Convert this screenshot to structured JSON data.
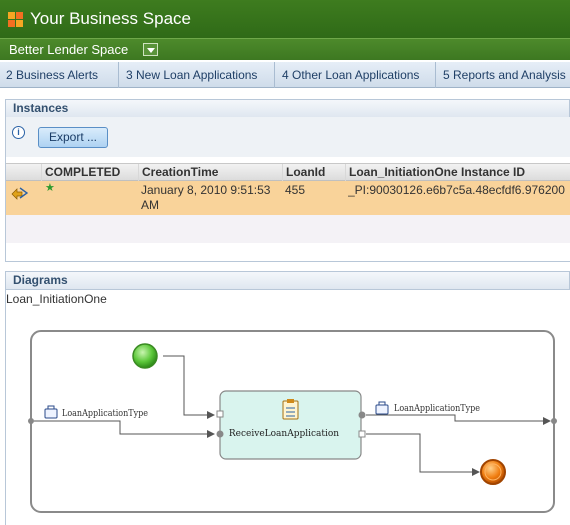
{
  "header": {
    "app_title": "Your Business Space",
    "space_name": "Better Lender Space"
  },
  "tabs": [
    {
      "label": "2 Business Alerts"
    },
    {
      "label": "3 New Loan Applications"
    },
    {
      "label": "4 Other Loan Applications"
    },
    {
      "label": "5 Reports and Analysis"
    }
  ],
  "instances": {
    "title": "Instances",
    "export_label": "Export ...",
    "columns": [
      "COMPLETED",
      "CreationTime",
      "LoanId",
      "Loan_InitiationOne Instance ID"
    ],
    "rows": [
      {
        "completed": "★",
        "creation_time_line1": "January 8, 2010 9:51:53",
        "creation_time_line2": "AM",
        "loan_id": "455",
        "instance_id": "_PI:90030126.e6b7c5a.48ecfdf6.976200"
      }
    ]
  },
  "diagrams": {
    "title": "Diagrams",
    "process_name": "Loan_InitiationOne",
    "input_label": "LoanApplicationType",
    "output_label": "LoanApplicationType",
    "activity_label": "ReceiveLoanApplication"
  },
  "colors": {
    "header_green": "#3e7c1f",
    "selected_row": "#f9d39a",
    "activity_fill": "#d9f4ee",
    "start_event": "#5cc83a",
    "end_event": "#f07d10"
  }
}
